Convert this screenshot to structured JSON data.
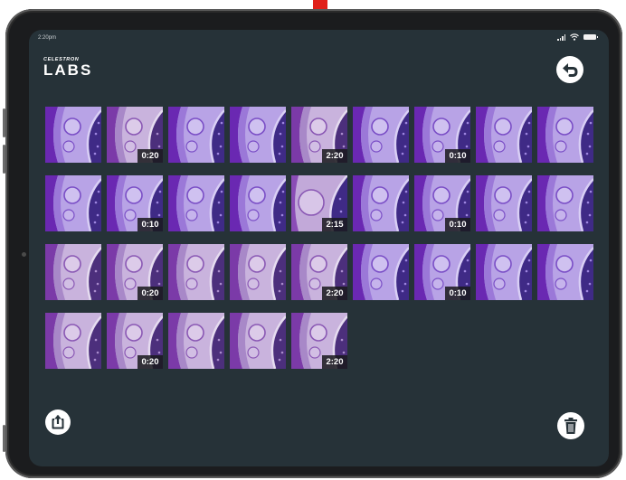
{
  "status_bar": {
    "time": "2:20pm"
  },
  "logo": {
    "brand": "CELESTRON",
    "product": "LABS"
  },
  "icons": {
    "back": "undo-arrow-icon",
    "export": "export-icon",
    "delete": "trash-icon",
    "pointer": "red-arrow-icon"
  },
  "colors": {
    "screen_background": "#263238",
    "annotation_arrow": "#e0211a",
    "stain_purple": "#6c2bb4",
    "stain_lavender": "#b9a6e6"
  },
  "gallery": {
    "items": [
      {
        "duration": "",
        "variant": 0
      },
      {
        "duration": "0:20",
        "variant": 1
      },
      {
        "duration": "",
        "variant": 0
      },
      {
        "duration": "",
        "variant": 0
      },
      {
        "duration": "2:20",
        "variant": 1
      },
      {
        "duration": "",
        "variant": 0
      },
      {
        "duration": "0:10",
        "variant": 0
      },
      {
        "duration": "",
        "variant": 0
      },
      {
        "duration": "",
        "variant": 0
      },
      {
        "duration": "",
        "variant": 0
      },
      {
        "duration": "0:10",
        "variant": 0
      },
      {
        "duration": "",
        "variant": 0
      },
      {
        "duration": "",
        "variant": 0
      },
      {
        "duration": "2:15",
        "variant": 2
      },
      {
        "duration": "",
        "variant": 0
      },
      {
        "duration": "0:10",
        "variant": 0
      },
      {
        "duration": "",
        "variant": 0
      },
      {
        "duration": "",
        "variant": 0
      },
      {
        "duration": "",
        "variant": 1
      },
      {
        "duration": "0:20",
        "variant": 1
      },
      {
        "duration": "",
        "variant": 1
      },
      {
        "duration": "",
        "variant": 1
      },
      {
        "duration": "2:20",
        "variant": 1
      },
      {
        "duration": "",
        "variant": 0
      },
      {
        "duration": "0:10",
        "variant": 0
      },
      {
        "duration": "",
        "variant": 0
      },
      {
        "duration": "",
        "variant": 0
      },
      {
        "duration": "",
        "variant": 1
      },
      {
        "duration": "0:20",
        "variant": 1
      },
      {
        "duration": "",
        "variant": 1
      },
      {
        "duration": "",
        "variant": 1
      },
      {
        "duration": "2:20",
        "variant": 1
      }
    ]
  }
}
